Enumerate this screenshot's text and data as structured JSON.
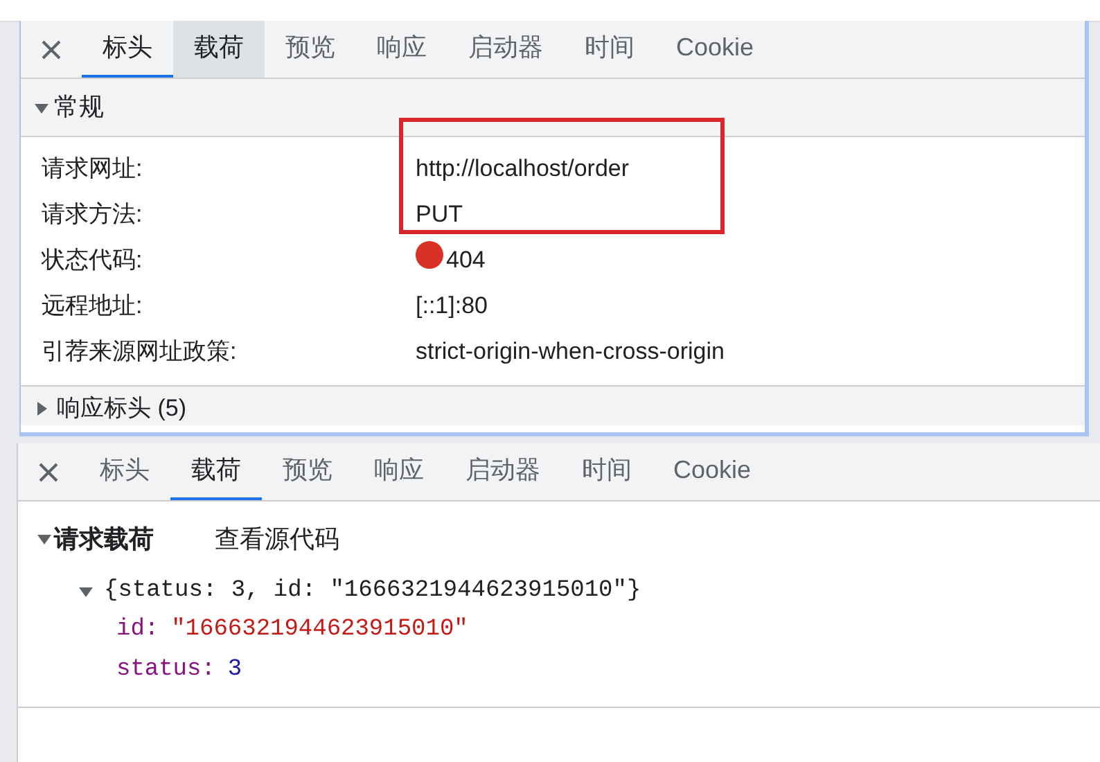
{
  "panels": [
    {
      "tabs": [
        {
          "label": "标头",
          "selected": true,
          "hovered": false
        },
        {
          "label": "载荷",
          "selected": false,
          "hovered": true
        },
        {
          "label": "预览",
          "selected": false,
          "hovered": false
        },
        {
          "label": "响应",
          "selected": false,
          "hovered": false
        },
        {
          "label": "启动器",
          "selected": false,
          "hovered": false
        },
        {
          "label": "时间",
          "selected": false,
          "hovered": false
        },
        {
          "label": "Cookie",
          "selected": false,
          "hovered": false
        }
      ],
      "kind": "headers",
      "general": {
        "title": "常规",
        "expanded": true,
        "rows": [
          {
            "label": "请求网址:",
            "value": "http://localhost/order",
            "highlighted": true
          },
          {
            "label": "请求方法:",
            "value": "PUT",
            "highlighted": true
          },
          {
            "label": "状态代码:",
            "value": "404",
            "highlighted": false,
            "color": "#d93025"
          },
          {
            "label": "远程地址:",
            "value": "[::1]:80",
            "highlighted": false
          },
          {
            "label": "引荐来源网址政策:",
            "value": "strict-origin-when-cross-origin",
            "highlighted": false
          }
        ]
      },
      "response_headers": {
        "title": "响应标头 (5)",
        "expanded": false
      }
    },
    {
      "tabs": [
        {
          "label": "标头",
          "selected": false,
          "hovered": false
        },
        {
          "label": "载荷",
          "selected": true,
          "hovered": false
        },
        {
          "label": "预览",
          "selected": false,
          "hovered": false
        },
        {
          "label": "响应",
          "selected": false,
          "hovered": false
        },
        {
          "label": "启动器",
          "selected": false,
          "hovered": false
        },
        {
          "label": "时间",
          "selected": false,
          "hovered": false
        },
        {
          "label": "Cookie",
          "selected": false,
          "hovered": false
        }
      ],
      "kind": "payload",
      "payload": {
        "title": "请求载荷",
        "expanded": true,
        "view_source": "查看源代码",
        "summary": "{status: 3, id: \"1666321944623915010\"}",
        "summary_expanded": true,
        "properties": [
          {
            "key": "id:",
            "value": "\"1666321944623915010\"",
            "kind": "string"
          },
          {
            "key": "status:",
            "value": "3",
            "kind": "number"
          }
        ]
      }
    }
  ]
}
